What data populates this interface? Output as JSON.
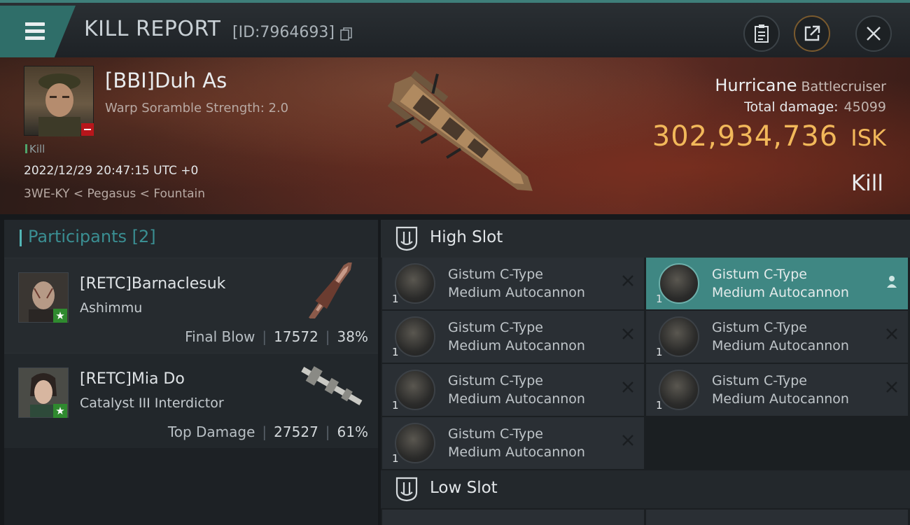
{
  "window": {
    "title": "KILL REPORT",
    "id_label": "[ID:7964693]"
  },
  "victim": {
    "name": "[BBI]Duh As",
    "subtitle": "Warp Soramble Strength: 2.0",
    "kill_tag": "Kill",
    "datetime": "2022/12/29 20:47:15 UTC +0",
    "location": "3WE-KY < Pegasus < Fountain"
  },
  "ship": {
    "name": "Hurricane",
    "class": "Battlecruiser",
    "total_damage_label": "Total damage:",
    "total_damage": "45099",
    "isk_value": "302,934,736",
    "isk_currency": "ISK",
    "result": "Kill"
  },
  "participants": {
    "header": "Participants",
    "count": "[2]",
    "list": [
      {
        "name": "[RETC]Barnaclesuk",
        "ship": "Ashimmu",
        "role": "Final Blow",
        "damage": "17572",
        "percent": "38%"
      },
      {
        "name": "[RETC]Mia Do",
        "ship": "Catalyst III Interdictor",
        "role": "Top Damage",
        "damage": "27527",
        "percent": "61%"
      }
    ]
  },
  "slots": {
    "high": {
      "label": "High Slot",
      "modules": [
        {
          "qty": "1",
          "line1": "Gistum C-Type",
          "line2": "Medium Autocannon",
          "status": "destroyed"
        },
        {
          "qty": "1",
          "line1": "Gistum C-Type",
          "line2": "Medium Autocannon",
          "status": "dropped"
        },
        {
          "qty": "1",
          "line1": "Gistum C-Type",
          "line2": "Medium Autocannon",
          "status": "destroyed"
        },
        {
          "qty": "1",
          "line1": "Gistum C-Type",
          "line2": "Medium Autocannon",
          "status": "destroyed"
        },
        {
          "qty": "1",
          "line1": "Gistum C-Type",
          "line2": "Medium Autocannon",
          "status": "destroyed"
        },
        {
          "qty": "1",
          "line1": "Gistum C-Type",
          "line2": "Medium Autocannon",
          "status": "destroyed"
        },
        {
          "qty": "1",
          "line1": "Gistum C-Type",
          "line2": "Medium Autocannon",
          "status": "destroyed"
        }
      ]
    },
    "low": {
      "label": "Low Slot"
    }
  },
  "icons": {
    "menu": "hamburger-menu-icon",
    "copy": "copy-icon",
    "clipboard": "clipboard-icon",
    "share": "share-icon",
    "close": "close-icon",
    "slot": "slot-icon",
    "remove": "close-x-icon",
    "pilot": "pilot-icon"
  },
  "colors": {
    "accent": "#3f8783",
    "isk": "#f2b85a",
    "participants_header": "#3a8e92",
    "badge_red": "#b8161b",
    "badge_green": "#2f8a2f"
  }
}
